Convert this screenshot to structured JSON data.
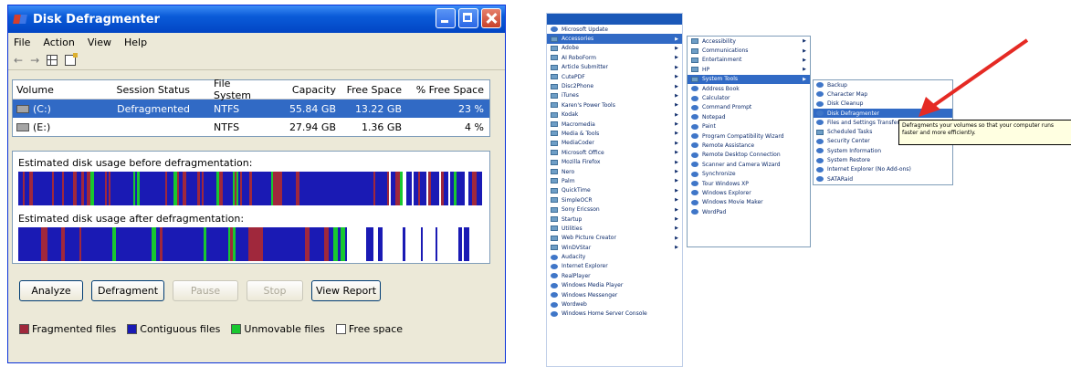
{
  "window": {
    "title": "Disk Defragmenter",
    "menu": [
      "File",
      "Action",
      "View",
      "Help"
    ],
    "toolbar": {
      "back": "←",
      "forward": "→"
    }
  },
  "volumes": {
    "headers": [
      "Volume",
      "Session Status",
      "File System",
      "Capacity",
      "Free Space",
      "% Free Space"
    ],
    "rows": [
      {
        "volume": "(C:)",
        "status": "Defragmented",
        "fs": "NTFS",
        "capacity": "55.84 GB",
        "free": "13.22 GB",
        "pct": "23 %"
      },
      {
        "volume": "(E:)",
        "status": "",
        "fs": "NTFS",
        "capacity": "27.94 GB",
        "free": "1.36 GB",
        "pct": "4 %"
      }
    ]
  },
  "usage": {
    "before_label": "Estimated disk usage before defragmentation:",
    "after_label": "Estimated disk usage after defragmentation:"
  },
  "buttons": {
    "analyze": "Analyze",
    "defragment": "Defragment",
    "pause": "Pause",
    "stop": "Stop",
    "view_report": "View Report"
  },
  "legend": [
    {
      "label": "Fragmented files",
      "color": "#a0283c"
    },
    {
      "label": "Contiguous files",
      "color": "#1a1ab4"
    },
    {
      "label": "Unmovable files",
      "color": "#18c830"
    },
    {
      "label": "Free space",
      "color": "#ffffff"
    }
  ],
  "colors": {
    "frag": "#a0283c",
    "contig": "#1a1ab4",
    "unmov": "#18c830",
    "free": "#ffffff"
  },
  "start_menu": {
    "col1": [
      {
        "label": "Microsoft Update",
        "icon": "update-icon",
        "arrow": false
      },
      {
        "label": "Accessories",
        "icon": "folder-icon",
        "arrow": true,
        "hl": true
      },
      {
        "label": "Adobe",
        "icon": "folder-icon",
        "arrow": true
      },
      {
        "label": "AI RoboForm",
        "icon": "folder-icon",
        "arrow": true
      },
      {
        "label": "Article Submitter",
        "icon": "folder-icon",
        "arrow": true
      },
      {
        "label": "CutePDF",
        "icon": "folder-icon",
        "arrow": true
      },
      {
        "label": "Disc2Phone",
        "icon": "folder-icon",
        "arrow": true
      },
      {
        "label": "iTunes",
        "icon": "folder-icon",
        "arrow": true
      },
      {
        "label": "Karen's Power Tools",
        "icon": "folder-icon",
        "arrow": true
      },
      {
        "label": "Kodak",
        "icon": "folder-icon",
        "arrow": true
      },
      {
        "label": "Macromedia",
        "icon": "folder-icon",
        "arrow": true
      },
      {
        "label": "Media & Tools",
        "icon": "folder-icon",
        "arrow": true
      },
      {
        "label": "MediaCoder",
        "icon": "folder-icon",
        "arrow": true
      },
      {
        "label": "Microsoft Office",
        "icon": "folder-icon",
        "arrow": true
      },
      {
        "label": "Mozilla Firefox",
        "icon": "folder-icon",
        "arrow": true
      },
      {
        "label": "Nero",
        "icon": "folder-icon",
        "arrow": true
      },
      {
        "label": "Palm",
        "icon": "folder-icon",
        "arrow": true
      },
      {
        "label": "QuickTime",
        "icon": "folder-icon",
        "arrow": true
      },
      {
        "label": "SimpleOCR",
        "icon": "folder-icon",
        "arrow": true
      },
      {
        "label": "Sony Ericsson",
        "icon": "folder-icon",
        "arrow": true
      },
      {
        "label": "Startup",
        "icon": "folder-icon",
        "arrow": true
      },
      {
        "label": "Utilities",
        "icon": "folder-icon",
        "arrow": true
      },
      {
        "label": "Web Picture Creator",
        "icon": "folder-icon",
        "arrow": true
      },
      {
        "label": "WinDVStar",
        "icon": "folder-icon",
        "arrow": true
      },
      {
        "label": "Audacity",
        "icon": "app-icon",
        "arrow": false
      },
      {
        "label": "Internet Explorer",
        "icon": "app-icon",
        "arrow": false
      },
      {
        "label": "RealPlayer",
        "icon": "app-icon",
        "arrow": false
      },
      {
        "label": "Windows Media Player",
        "icon": "app-icon",
        "arrow": false
      },
      {
        "label": "Windows Messenger",
        "icon": "app-icon",
        "arrow": false
      },
      {
        "label": "Wordweb",
        "icon": "app-icon",
        "arrow": false
      },
      {
        "label": "Windows Home Server Console",
        "icon": "app-icon",
        "arrow": false
      }
    ],
    "col2": [
      {
        "label": "Accessibility",
        "icon": "folder-icon",
        "arrow": true
      },
      {
        "label": "Communications",
        "icon": "folder-icon",
        "arrow": true
      },
      {
        "label": "Entertainment",
        "icon": "folder-icon",
        "arrow": true
      },
      {
        "label": "HP",
        "icon": "folder-icon",
        "arrow": true
      },
      {
        "label": "System Tools",
        "icon": "folder-icon",
        "arrow": true,
        "hl": true
      },
      {
        "label": "Address Book",
        "icon": "app-icon",
        "arrow": false
      },
      {
        "label": "Calculator",
        "icon": "app-icon",
        "arrow": false
      },
      {
        "label": "Command Prompt",
        "icon": "app-icon",
        "arrow": false
      },
      {
        "label": "Notepad",
        "icon": "app-icon",
        "arrow": false
      },
      {
        "label": "Paint",
        "icon": "app-icon",
        "arrow": false
      },
      {
        "label": "Program Compatibility Wizard",
        "icon": "app-icon",
        "arrow": false
      },
      {
        "label": "Remote Assistance",
        "icon": "app-icon",
        "arrow": false
      },
      {
        "label": "Remote Desktop Connection",
        "icon": "app-icon",
        "arrow": false
      },
      {
        "label": "Scanner and Camera Wizard",
        "icon": "app-icon",
        "arrow": false
      },
      {
        "label": "Synchronize",
        "icon": "app-icon",
        "arrow": false
      },
      {
        "label": "Tour Windows XP",
        "icon": "app-icon",
        "arrow": false
      },
      {
        "label": "Windows Explorer",
        "icon": "app-icon",
        "arrow": false
      },
      {
        "label": "Windows Movie Maker",
        "icon": "app-icon",
        "arrow": false
      },
      {
        "label": "WordPad",
        "icon": "app-icon",
        "arrow": false
      }
    ],
    "col3": [
      {
        "label": "Backup",
        "icon": "app-icon",
        "arrow": false
      },
      {
        "label": "Character Map",
        "icon": "app-icon",
        "arrow": false
      },
      {
        "label": "Disk Cleanup",
        "icon": "app-icon",
        "arrow": false
      },
      {
        "label": "Disk Defragmenter",
        "icon": "app-icon",
        "arrow": false,
        "hl": true
      },
      {
        "label": "Files and Settings Transfer Wizard",
        "icon": "app-icon",
        "arrow": false
      },
      {
        "label": "Scheduled Tasks",
        "icon": "folder-icon",
        "arrow": false
      },
      {
        "label": "Security Center",
        "icon": "app-icon",
        "arrow": false
      },
      {
        "label": "System Information",
        "icon": "app-icon",
        "arrow": false
      },
      {
        "label": "System Restore",
        "icon": "app-icon",
        "arrow": false
      },
      {
        "label": "Internet Explorer (No Add-ons)",
        "icon": "app-icon",
        "arrow": false
      },
      {
        "label": "SATARaid",
        "icon": "app-icon",
        "arrow": false
      }
    ],
    "tooltip": "Defragments your volumes so that your computer runs faster and more efficiently."
  }
}
